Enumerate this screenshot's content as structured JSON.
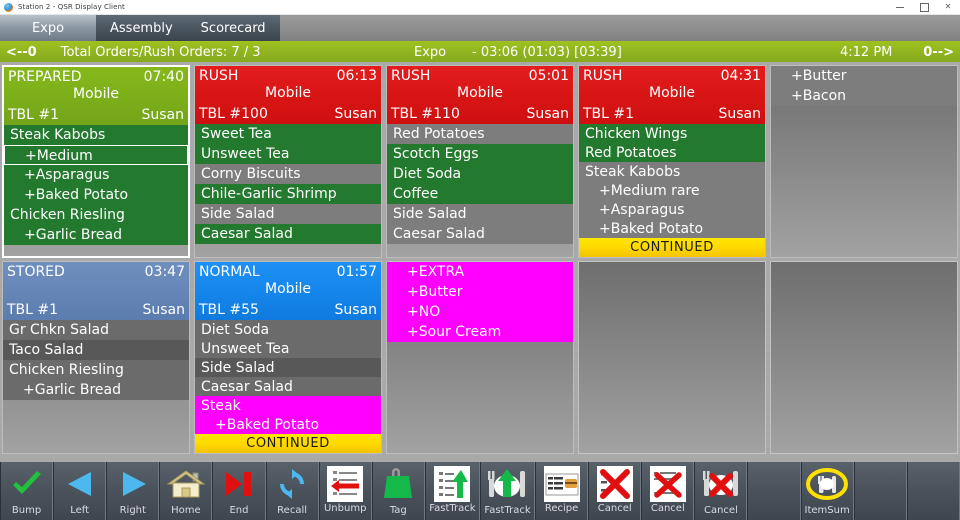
{
  "window": {
    "title": "Station 2 - QSR Display Client",
    "controls": {
      "minimize": "minimize",
      "maximize": "maximize",
      "close": "close"
    }
  },
  "tabs": [
    {
      "label": "Expo",
      "active": true
    },
    {
      "label": "Assembly",
      "active": false
    },
    {
      "label": "Scorecard",
      "active": false
    }
  ],
  "status": {
    "left_arrow": "<--0",
    "totals": "Total Orders/Rush Orders: 7 / 3",
    "station": "Expo",
    "timers": "- 03:06 (01:03) [03:39]",
    "clock": "4:12 PM",
    "right_arrow": "0-->"
  },
  "orders": [
    {
      "state": "PREPARED",
      "timer": "07:40",
      "channel": "Mobile",
      "table": "TBL #1",
      "server": "Susan",
      "header_color": "#7cae1a",
      "selected": true,
      "continued": null,
      "items": [
        {
          "text": "Steak Kabobs",
          "sub": false,
          "style": "g",
          "selected": false
        },
        {
          "text": "+Medium",
          "sub": true,
          "style": "g",
          "selected": true
        },
        {
          "text": "+Asparagus",
          "sub": true,
          "style": "g",
          "selected": false
        },
        {
          "text": "+Baked Potato",
          "sub": true,
          "style": "g",
          "selected": false
        },
        {
          "text": "Chicken Riesling",
          "sub": false,
          "style": "g",
          "selected": false
        },
        {
          "text": "+Garlic Bread",
          "sub": true,
          "style": "g",
          "selected": false
        }
      ]
    },
    {
      "state": "RUSH",
      "timer": "06:13",
      "channel": "Mobile",
      "table": "TBL #100",
      "server": "Susan",
      "header_color": "#d81515",
      "selected": false,
      "continued": null,
      "items": [
        {
          "text": "Sweet Tea",
          "sub": false,
          "style": "g",
          "selected": false
        },
        {
          "text": "Unsweet Tea",
          "sub": false,
          "style": "g",
          "selected": false
        },
        {
          "text": "Corny Biscuits",
          "sub": false,
          "style": "s1",
          "selected": false
        },
        {
          "text": "Chile-Garlic Shrimp",
          "sub": false,
          "style": "g",
          "selected": false
        },
        {
          "text": "Side Salad",
          "sub": false,
          "style": "s1",
          "selected": false
        },
        {
          "text": "Caesar Salad",
          "sub": false,
          "style": "g",
          "selected": false
        }
      ]
    },
    {
      "state": "RUSH",
      "timer": "05:01",
      "channel": "Mobile",
      "table": "TBL #110",
      "server": "Susan",
      "header_color": "#d81515",
      "selected": false,
      "continued": null,
      "items": [
        {
          "text": "Red Potatoes",
          "sub": false,
          "style": "s1",
          "selected": false
        },
        {
          "text": "Scotch Eggs",
          "sub": false,
          "style": "g",
          "selected": false
        },
        {
          "text": "Diet Soda",
          "sub": false,
          "style": "g",
          "selected": false
        },
        {
          "text": "Coffee",
          "sub": false,
          "style": "g",
          "selected": false
        },
        {
          "text": "Side Salad",
          "sub": false,
          "style": "s1",
          "selected": false
        },
        {
          "text": "Caesar Salad",
          "sub": false,
          "style": "s1",
          "selected": false
        }
      ]
    },
    {
      "state": "RUSH",
      "timer": "04:31",
      "channel": "Mobile",
      "table": "TBL #1",
      "server": "Susan",
      "header_color": "#d81515",
      "selected": false,
      "continued": "CONTINUED",
      "items": [
        {
          "text": "Chicken Wings",
          "sub": false,
          "style": "g",
          "selected": false
        },
        {
          "text": "Red Potatoes",
          "sub": false,
          "style": "g",
          "selected": false
        },
        {
          "text": "Steak Kabobs",
          "sub": false,
          "style": "s1",
          "selected": false
        },
        {
          "text": "+Medium rare",
          "sub": true,
          "style": "s1",
          "selected": false
        },
        {
          "text": "+Asparagus",
          "sub": true,
          "style": "s1",
          "selected": false
        },
        {
          "text": "+Baked Potato",
          "sub": true,
          "style": "s1",
          "selected": false
        }
      ]
    },
    {
      "state": null,
      "timer": null,
      "channel": null,
      "table": null,
      "server": null,
      "header_color": null,
      "selected": false,
      "continued": null,
      "items": [
        {
          "text": "+Butter",
          "sub": true,
          "style": "s1",
          "selected": false
        },
        {
          "text": "+Bacon",
          "sub": true,
          "style": "s1",
          "selected": false
        }
      ]
    },
    {
      "state": "STORED",
      "timer": "03:47",
      "channel": "",
      "table": "TBL #1",
      "server": "Susan",
      "header_color": "#6485b6",
      "selected": false,
      "continued": null,
      "caret": true,
      "items": [
        {
          "text": "Gr Chkn Salad",
          "sub": false,
          "style": "s2",
          "selected": false
        },
        {
          "text": "Taco Salad",
          "sub": false,
          "style": "s3",
          "selected": false
        },
        {
          "text": "Chicken Riesling",
          "sub": false,
          "style": "s2",
          "selected": false
        },
        {
          "text": "+Garlic Bread",
          "sub": true,
          "style": "s2",
          "selected": false
        }
      ]
    },
    {
      "state": "NORMAL",
      "timer": "01:57",
      "channel": "Mobile",
      "table": "TBL #55",
      "server": "Susan",
      "header_color": "#1585ea",
      "selected": false,
      "continued": "CONTINUED",
      "items": [
        {
          "text": "Diet Soda",
          "sub": false,
          "style": "s2",
          "selected": false
        },
        {
          "text": "Unsweet Tea",
          "sub": false,
          "style": "s2",
          "selected": false
        },
        {
          "text": "Side Salad",
          "sub": false,
          "style": "s3",
          "selected": false
        },
        {
          "text": "Caesar Salad",
          "sub": false,
          "style": "s2",
          "selected": false
        },
        {
          "text": "Steak",
          "sub": false,
          "style": "m",
          "selected": false
        },
        {
          "text": "+Baked Potato",
          "sub": true,
          "style": "m",
          "selected": false
        }
      ]
    },
    {
      "state": null,
      "timer": null,
      "channel": null,
      "table": null,
      "server": null,
      "header_color": null,
      "selected": false,
      "continued": null,
      "items": [
        {
          "text": "+EXTRA",
          "sub": true,
          "style": "m",
          "selected": false
        },
        {
          "text": "+Butter",
          "sub": true,
          "style": "m",
          "selected": false
        },
        {
          "text": "+NO",
          "sub": true,
          "style": "m",
          "selected": false
        },
        {
          "text": "+Sour Cream",
          "sub": true,
          "style": "m",
          "selected": false
        }
      ]
    }
  ],
  "toolbar": [
    {
      "label": "Bump",
      "icon": "checkmark-icon"
    },
    {
      "label": "Left",
      "icon": "triangle-left-icon"
    },
    {
      "label": "Right",
      "icon": "triangle-right-icon"
    },
    {
      "label": "Home",
      "icon": "home-icon"
    },
    {
      "label": "End",
      "icon": "skip-end-icon"
    },
    {
      "label": "Recall",
      "icon": "refresh-cycle-icon"
    },
    {
      "label": "Unbump",
      "icon": "unbump-arrow-left-icon"
    },
    {
      "label": "Tag",
      "icon": "tag-icon"
    },
    {
      "label": "FastTrack",
      "icon": "fasttrack-list-up-icon"
    },
    {
      "label": "FastTrack",
      "icon": "fasttrack-plate-up-icon"
    },
    {
      "label": "Recipe",
      "icon": "recipe-card-icon"
    },
    {
      "label": "Cancel",
      "icon": "cancel-x-icon"
    },
    {
      "label": "Cancel",
      "icon": "cancel-list-x-icon"
    },
    {
      "label": "Cancel",
      "icon": "cancel-plate-x-icon"
    },
    {
      "label": "",
      "icon": "blank-icon"
    },
    {
      "label": "ItemSum",
      "icon": "itemsum-plate-icon"
    },
    {
      "label": "",
      "icon": "blank-icon"
    },
    {
      "label": "",
      "icon": "blank-icon"
    }
  ],
  "colors": {
    "rush": "#d81515",
    "prepared": "#7cae1a",
    "normal": "#1585ea",
    "stored": "#6485b6",
    "continued": "#ffd900",
    "modifier_highlight": "#ff00ff",
    "status_bar": "#8fb320"
  }
}
